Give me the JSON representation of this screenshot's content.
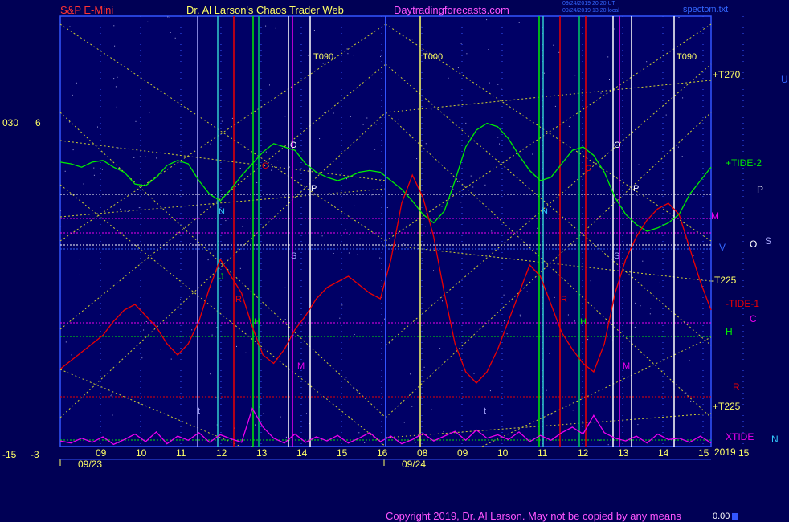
{
  "header": {
    "instrument": "S&P E-Mini",
    "site_title": "Dr. Al Larson's Chaos Trader Web",
    "site_url": "Daytradingforecasts.com",
    "file_name": "spectom.txt",
    "stamp_line1": "09/24/2019 20:20 UT",
    "stamp_line2": "09/24/2019 13:20 local"
  },
  "footer": {
    "copyright": "Copyright 2019, Dr. Al Larson. May not be copied by any means",
    "readout": "0.00"
  },
  "colors": {
    "background": "#000055",
    "plot_border": "#3355ff",
    "tide": "#00ee00",
    "tide1": "#ee0000",
    "xtide": "#ee00ee",
    "text_yellow": "#ffff66",
    "text_magenta": "#ff55ff"
  },
  "chart_data": {
    "type": "line",
    "title": "",
    "xlabel": "",
    "ylabel": "",
    "dates": [
      {
        "label": "09/23",
        "start_hour": 8
      },
      {
        "label": "09/24",
        "start_hour": 8
      }
    ],
    "hour_ticks": [
      "09",
      "10",
      "11",
      "12",
      "13",
      "14",
      "15",
      "16",
      "08",
      "09",
      "10",
      "11",
      "12",
      "13",
      "14",
      "15",
      "15"
    ],
    "axis_left": {
      "top_label_1": "030",
      "top_label_2": "6",
      "bottom_label_1": "-15",
      "bottom_label_2": "-3"
    },
    "year_label": "2019",
    "series": [
      {
        "name": "+TIDE-2",
        "color": "#00ee00",
        "values": [
          0.61,
          0.6,
          0.58,
          0.61,
          0.62,
          0.58,
          0.55,
          0.48,
          0.47,
          0.52,
          0.59,
          0.62,
          0.6,
          0.5,
          0.42,
          0.38,
          0.45,
          0.53,
          0.6,
          0.67,
          0.72,
          0.7,
          0.68,
          0.6,
          0.55,
          0.52,
          0.5,
          0.52,
          0.55,
          0.56,
          0.55,
          0.5,
          0.45,
          0.38,
          0.3,
          0.25,
          0.32,
          0.5,
          0.7,
          0.8,
          0.84,
          0.82,
          0.75,
          0.65,
          0.56,
          0.5,
          0.52,
          0.6,
          0.68,
          0.7,
          0.65,
          0.55,
          0.4,
          0.3,
          0.24,
          0.2,
          0.22,
          0.25,
          0.3,
          0.42,
          0.5,
          0.58
        ]
      },
      {
        "name": "-TIDE-1",
        "color": "#ee0000",
        "values": [
          0.03,
          0.06,
          0.09,
          0.12,
          0.15,
          0.2,
          0.24,
          0.26,
          0.22,
          0.18,
          0.12,
          0.08,
          0.12,
          0.2,
          0.32,
          0.42,
          0.36,
          0.3,
          0.18,
          0.08,
          0.05,
          0.1,
          0.17,
          0.22,
          0.28,
          0.32,
          0.34,
          0.36,
          0.33,
          0.3,
          0.28,
          0.42,
          0.62,
          0.72,
          0.64,
          0.5,
          0.3,
          0.12,
          0.02,
          -0.02,
          0.02,
          0.1,
          0.2,
          0.3,
          0.4,
          0.36,
          0.26,
          0.16,
          0.1,
          0.05,
          0.02,
          0.12,
          0.3,
          0.42,
          0.5,
          0.56,
          0.6,
          0.62,
          0.58,
          0.46,
          0.34,
          0.24
        ]
      },
      {
        "name": "XTIDE",
        "color": "#ee00ee",
        "values": [
          0.08,
          0.05,
          0.12,
          0.06,
          0.14,
          0.03,
          0.1,
          0.18,
          0.07,
          0.21,
          0.04,
          0.15,
          0.09,
          0.2,
          0.06,
          0.17,
          0.11,
          0.06,
          0.55,
          0.28,
          0.12,
          0.05,
          0.18,
          0.06,
          0.14,
          0.08,
          0.16,
          0.05,
          0.12,
          0.2,
          0.07,
          0.15,
          0.04,
          0.1,
          0.19,
          0.08,
          0.15,
          0.22,
          0.09,
          0.24,
          0.12,
          0.17,
          0.1,
          0.21,
          0.07,
          0.16,
          0.09,
          0.2,
          0.28,
          0.18,
          0.45,
          0.2,
          0.12,
          0.08,
          0.15,
          0.05,
          0.18,
          0.1,
          0.12,
          0.06,
          0.15,
          0.05
        ]
      }
    ],
    "right_labels": [
      {
        "text": "+T270",
        "color": "#ffff66"
      },
      {
        "text": "+TIDE-2",
        "color": "#00ee00"
      },
      {
        "text": "M",
        "color": "#ee00ee"
      },
      {
        "text": "V",
        "color": "#3366ff"
      },
      {
        "text": "-T225",
        "color": "#ffff66"
      },
      {
        "text": "-TIDE-1",
        "color": "#ee0000"
      },
      {
        "text": "H",
        "color": "#00ee00"
      },
      {
        "text": "R",
        "color": "#ee0000"
      },
      {
        "text": "+T225",
        "color": "#ffff66"
      },
      {
        "text": "XTIDE",
        "color": "#ee00ee"
      }
    ],
    "far_right_labels": [
      {
        "text": "U",
        "color": "#3366ff"
      },
      {
        "text": "P",
        "color": "#ffffff"
      },
      {
        "text": "O",
        "color": "#ffffff"
      },
      {
        "text": "S",
        "color": "#aaaaff"
      },
      {
        "text": "C",
        "color": "#ee00ee"
      },
      {
        "text": "N",
        "color": "#33ccff"
      }
    ],
    "markers": [
      {
        "text": "T090",
        "color": "#ffff66"
      },
      {
        "text": "T000",
        "color": "#ffff66"
      },
      {
        "text": "T090",
        "color": "#ffff66"
      }
    ],
    "planet_letters": [
      {
        "text": "N",
        "color": "#33ccff"
      },
      {
        "text": "J",
        "color": "#00ee00"
      },
      {
        "text": "R",
        "color": "#ee0000"
      },
      {
        "text": "H",
        "color": "#00ee00"
      },
      {
        "text": "C",
        "color": "#ee0000"
      },
      {
        "text": "O",
        "color": "#ffffff"
      },
      {
        "text": "P",
        "color": "#ffffff"
      },
      {
        "text": "S",
        "color": "#aaaaff"
      },
      {
        "text": "M",
        "color": "#ee00ee"
      },
      {
        "text": "t",
        "color": "#aaaaff"
      },
      {
        "text": "N",
        "color": "#33ccff"
      },
      {
        "text": "C",
        "color": "#ee0000"
      },
      {
        "text": "O",
        "color": "#ffffff"
      },
      {
        "text": "P",
        "color": "#ffffff"
      },
      {
        "text": "S",
        "color": "#aaaaff"
      },
      {
        "text": "R",
        "color": "#ee0000"
      },
      {
        "text": "H",
        "color": "#00ee00"
      },
      {
        "text": "M",
        "color": "#ee00ee"
      },
      {
        "text": "t",
        "color": "#aaaaff"
      }
    ]
  }
}
